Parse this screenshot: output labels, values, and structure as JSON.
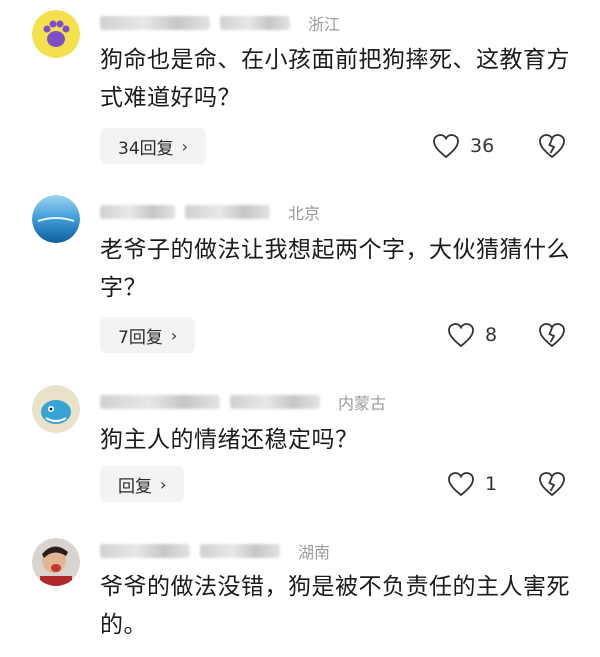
{
  "comments": [
    {
      "location": "浙江",
      "text": "狗命也是命、在小孩面前把狗摔死、这教育方式难道好吗？",
      "reply_label": "34回复",
      "likes": "36"
    },
    {
      "location": "北京",
      "text": "老爷子的做法让我想起两个字，大伙猜猜什么字？",
      "reply_label": "7回复",
      "likes": "8"
    },
    {
      "location": "内蒙古",
      "text": "狗主人的情绪还稳定吗？",
      "reply_label": "回复",
      "likes": "1"
    },
    {
      "location": "湖南",
      "text": "爷爷的做法没错，狗是被不负责任的主人害死的。",
      "reply_label": "",
      "likes": ""
    }
  ],
  "icons": {
    "like": "heart-outline-icon",
    "dislike": "broken-heart-icon",
    "reply_chevron": "chevron-right-icon"
  }
}
